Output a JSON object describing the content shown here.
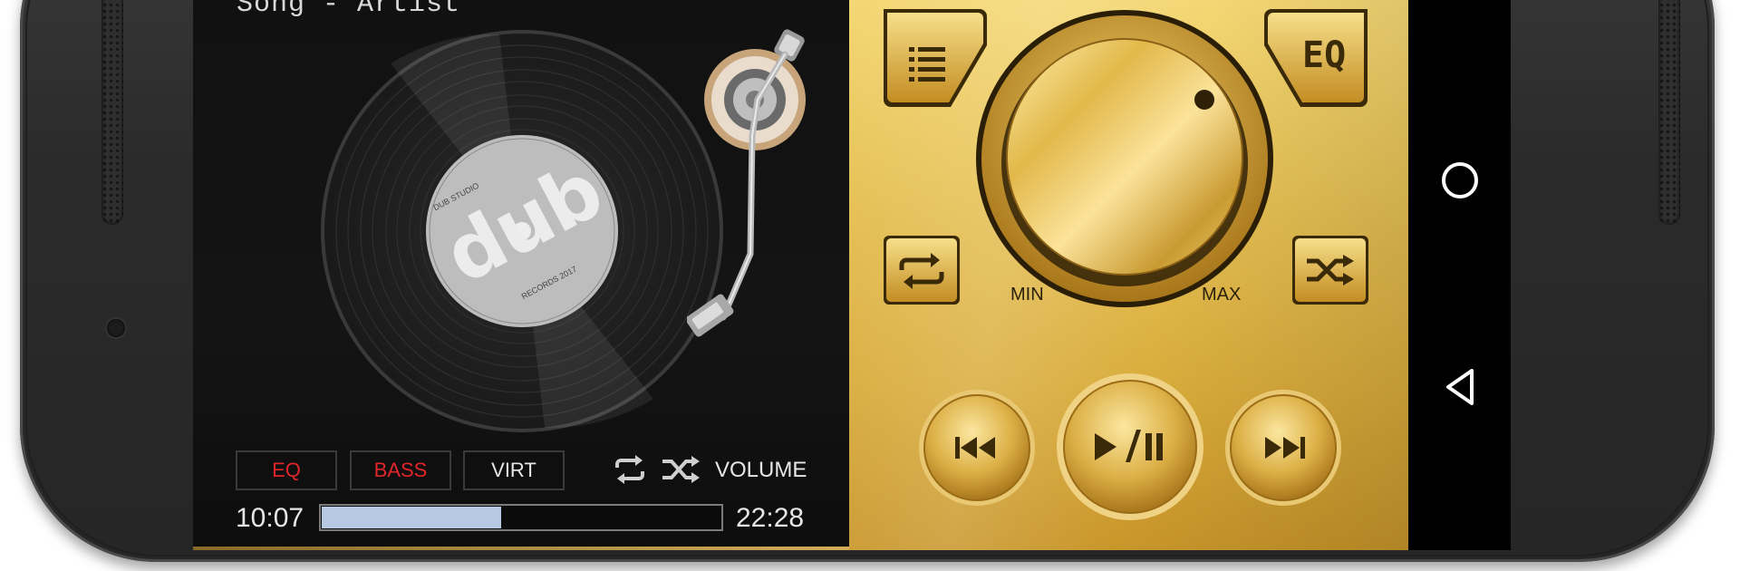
{
  "player": {
    "song_title": "Song - Artist",
    "record_label": {
      "brand": "dub",
      "top_text": "DUB STUDIO",
      "bottom_text": "RECORDS 2017"
    },
    "effects": [
      {
        "label": "EQ",
        "color": "#e0262b"
      },
      {
        "label": "BASS",
        "color": "#e0262b"
      },
      {
        "label": "VIRT",
        "color": "#e6e6e6"
      }
    ],
    "volume_label": "VOLUME",
    "time_elapsed": "10:07",
    "time_total": "22:28",
    "progress_fraction": 0.45
  },
  "gold_panel": {
    "playlist_icon": "list-icon",
    "eq_label": "EQ",
    "knob_min_label": "MIN",
    "knob_max_label": "MAX",
    "repeat_icon": "repeat-icon",
    "shuffle_icon": "shuffle-icon",
    "prev_icon": "previous-track-icon",
    "play_pause_icon": "play-pause-icon",
    "next_icon": "next-track-icon"
  },
  "nav_bar": {
    "home_icon": "home-circle-icon",
    "back_icon": "back-triangle-icon"
  },
  "colors": {
    "gold_light": "#f4d774",
    "gold_dark": "#c9962a",
    "accent_red": "#e0262b",
    "progress_fill": "#b7c8e3"
  }
}
